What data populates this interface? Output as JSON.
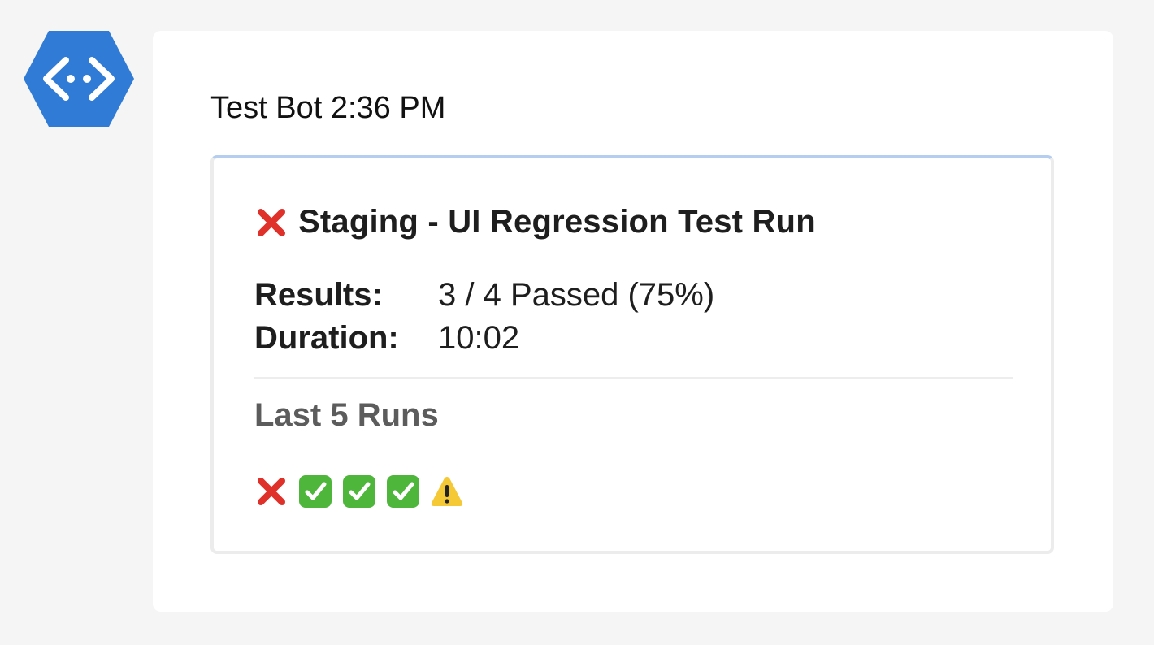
{
  "message": {
    "sender": "Test Bot",
    "time": "2:36 PM",
    "avatar_icon": "azure-bot-service-icon",
    "avatar_color": "#2f7bd6"
  },
  "card": {
    "status_icon": "red-cross-icon",
    "title": "Staging - UI Regression Test Run",
    "facts": [
      {
        "label": "Results:",
        "value": "3 / 4 Passed (75%)"
      },
      {
        "label": "Duration:",
        "value": "10:02"
      }
    ],
    "history_heading": "Last 5 Runs",
    "history": [
      {
        "status": "failed",
        "icon": "red-cross-icon"
      },
      {
        "status": "passed",
        "icon": "green-check-icon"
      },
      {
        "status": "passed",
        "icon": "green-check-icon"
      },
      {
        "status": "passed",
        "icon": "green-check-icon"
      },
      {
        "status": "warning",
        "icon": "warning-icon"
      }
    ],
    "accent_color": "#b5cdee",
    "fail_color": "#e0302a",
    "pass_color": "#4fb63c",
    "warning_color": "#f5c836"
  }
}
